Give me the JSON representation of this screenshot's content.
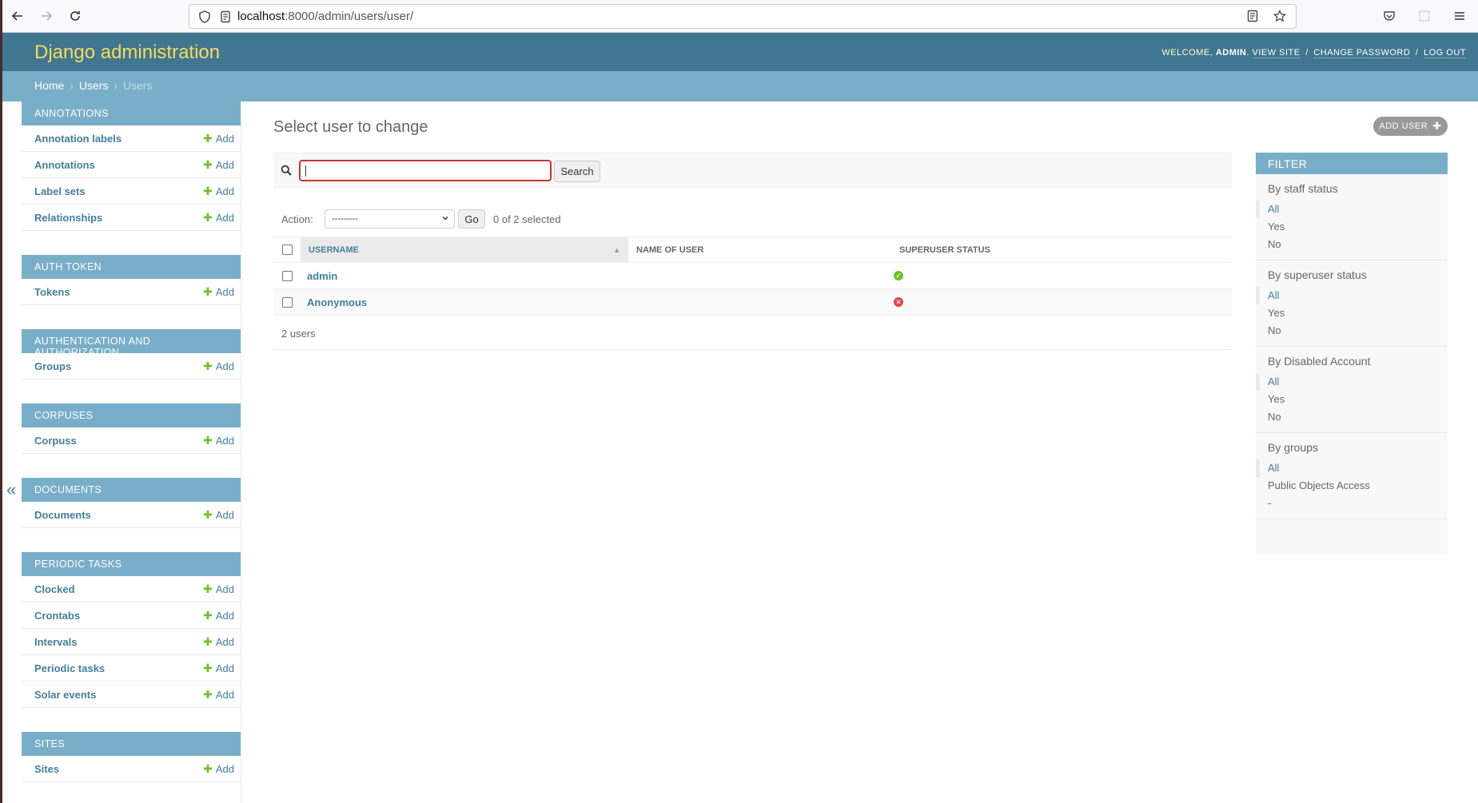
{
  "browser": {
    "url_host": "localhost",
    "url_path": ":8000/admin/users/user/"
  },
  "header": {
    "brand": "Django administration",
    "welcome": "Welcome,",
    "user": "admin",
    "view_site": "View site",
    "change_password": "Change password",
    "log_out": "Log out"
  },
  "breadcrumbs": {
    "home": "Home",
    "app": "Users",
    "current": "Users"
  },
  "sidebar": {
    "add_label": "Add",
    "modules": [
      {
        "caption": "Annotations",
        "items": [
          "Annotation labels",
          "Annotations",
          "Label sets",
          "Relationships"
        ]
      },
      {
        "caption": "Auth Token",
        "items": [
          "Tokens"
        ]
      },
      {
        "caption": "Authentication and Authorization",
        "items": [
          "Groups"
        ]
      },
      {
        "caption": "Corpuses",
        "items": [
          "Corpuss"
        ]
      },
      {
        "caption": "Documents",
        "items": [
          "Documents"
        ]
      },
      {
        "caption": "Periodic Tasks",
        "items": [
          "Clocked",
          "Crontabs",
          "Intervals",
          "Periodic tasks",
          "Solar events"
        ]
      },
      {
        "caption": "Sites",
        "items": [
          "Sites"
        ]
      }
    ]
  },
  "main": {
    "title": "Select user to change",
    "add_button": "Add user",
    "search_button": "Search",
    "search_value": "",
    "action_label": "Action:",
    "action_selected": "---------",
    "go_button": "Go",
    "selection_counter": "0 of 2 selected",
    "columns": [
      "Username",
      "Name of user",
      "Superuser status"
    ],
    "rows": [
      {
        "username": "admin",
        "name": "",
        "superuser": true
      },
      {
        "username": "Anonymous",
        "name": "",
        "superuser": false
      }
    ],
    "paginator": "2 users"
  },
  "filter": {
    "caption": "Filter",
    "groups": [
      {
        "title": "By staff status",
        "options": [
          "All",
          "Yes",
          "No"
        ],
        "selected": 0
      },
      {
        "title": "By superuser status",
        "options": [
          "All",
          "Yes",
          "No"
        ],
        "selected": 0
      },
      {
        "title": "By Disabled Account",
        "options": [
          "All",
          "Yes",
          "No"
        ],
        "selected": 0
      },
      {
        "title": "By groups",
        "options": [
          "All",
          "Public Objects Access",
          "-"
        ],
        "selected": 0
      }
    ]
  },
  "colors": {
    "header_bg": "#417690",
    "brand": "#f5dd5d",
    "caption_bg": "#79aec8",
    "link": "#447e9b",
    "add_plus": "#70bf2b",
    "no_icon": "#dd4646",
    "search_focus": "#c0392b"
  }
}
